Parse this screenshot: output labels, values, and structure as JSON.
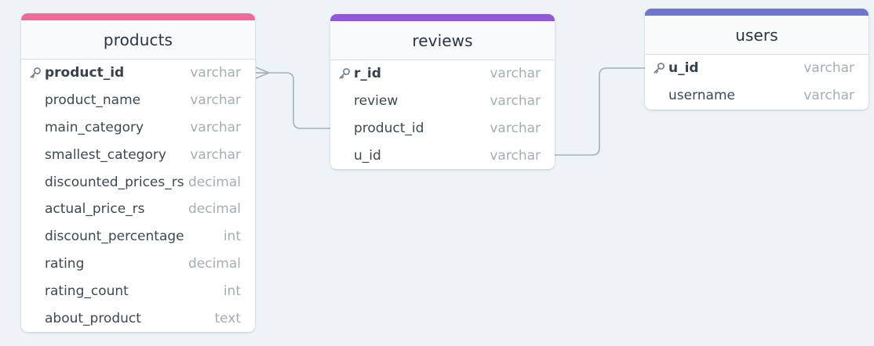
{
  "tables": {
    "products": {
      "name": "products",
      "accent": "#f06b9a",
      "fields": [
        {
          "name": "product_id",
          "type": "varchar",
          "pk": true
        },
        {
          "name": "product_name",
          "type": "varchar",
          "pk": false
        },
        {
          "name": "main_category",
          "type": "varchar",
          "pk": false
        },
        {
          "name": "smallest_category",
          "type": "varchar",
          "pk": false
        },
        {
          "name": "discounted_prices_rs",
          "type": "decimal",
          "pk": false
        },
        {
          "name": "actual_price_rs",
          "type": "decimal",
          "pk": false
        },
        {
          "name": "discount_percentage",
          "type": "int",
          "pk": false
        },
        {
          "name": "rating",
          "type": "decimal",
          "pk": false
        },
        {
          "name": "rating_count",
          "type": "int",
          "pk": false
        },
        {
          "name": "about_product",
          "type": "text",
          "pk": false
        }
      ]
    },
    "reviews": {
      "name": "reviews",
      "accent": "#8f5ad9",
      "fields": [
        {
          "name": "r_id",
          "type": "varchar",
          "pk": true
        },
        {
          "name": "review",
          "type": "varchar",
          "pk": false
        },
        {
          "name": "product_id",
          "type": "varchar",
          "pk": false
        },
        {
          "name": "u_id",
          "type": "varchar",
          "pk": false
        }
      ]
    },
    "users": {
      "name": "users",
      "accent": "#6c76d2",
      "fields": [
        {
          "name": "u_id",
          "type": "varchar",
          "pk": true
        },
        {
          "name": "username",
          "type": "varchar",
          "pk": false
        }
      ]
    }
  },
  "relationships": [
    {
      "from": "reviews.product_id",
      "to": "products.product_id",
      "to_cardinality": "many"
    },
    {
      "from": "reviews.u_id",
      "to": "users.u_id",
      "to_cardinality": "one"
    }
  ],
  "colors": {
    "canvas": "#eef3f7",
    "connector": "#a7b0bd",
    "key_icon": "#6b7684"
  }
}
